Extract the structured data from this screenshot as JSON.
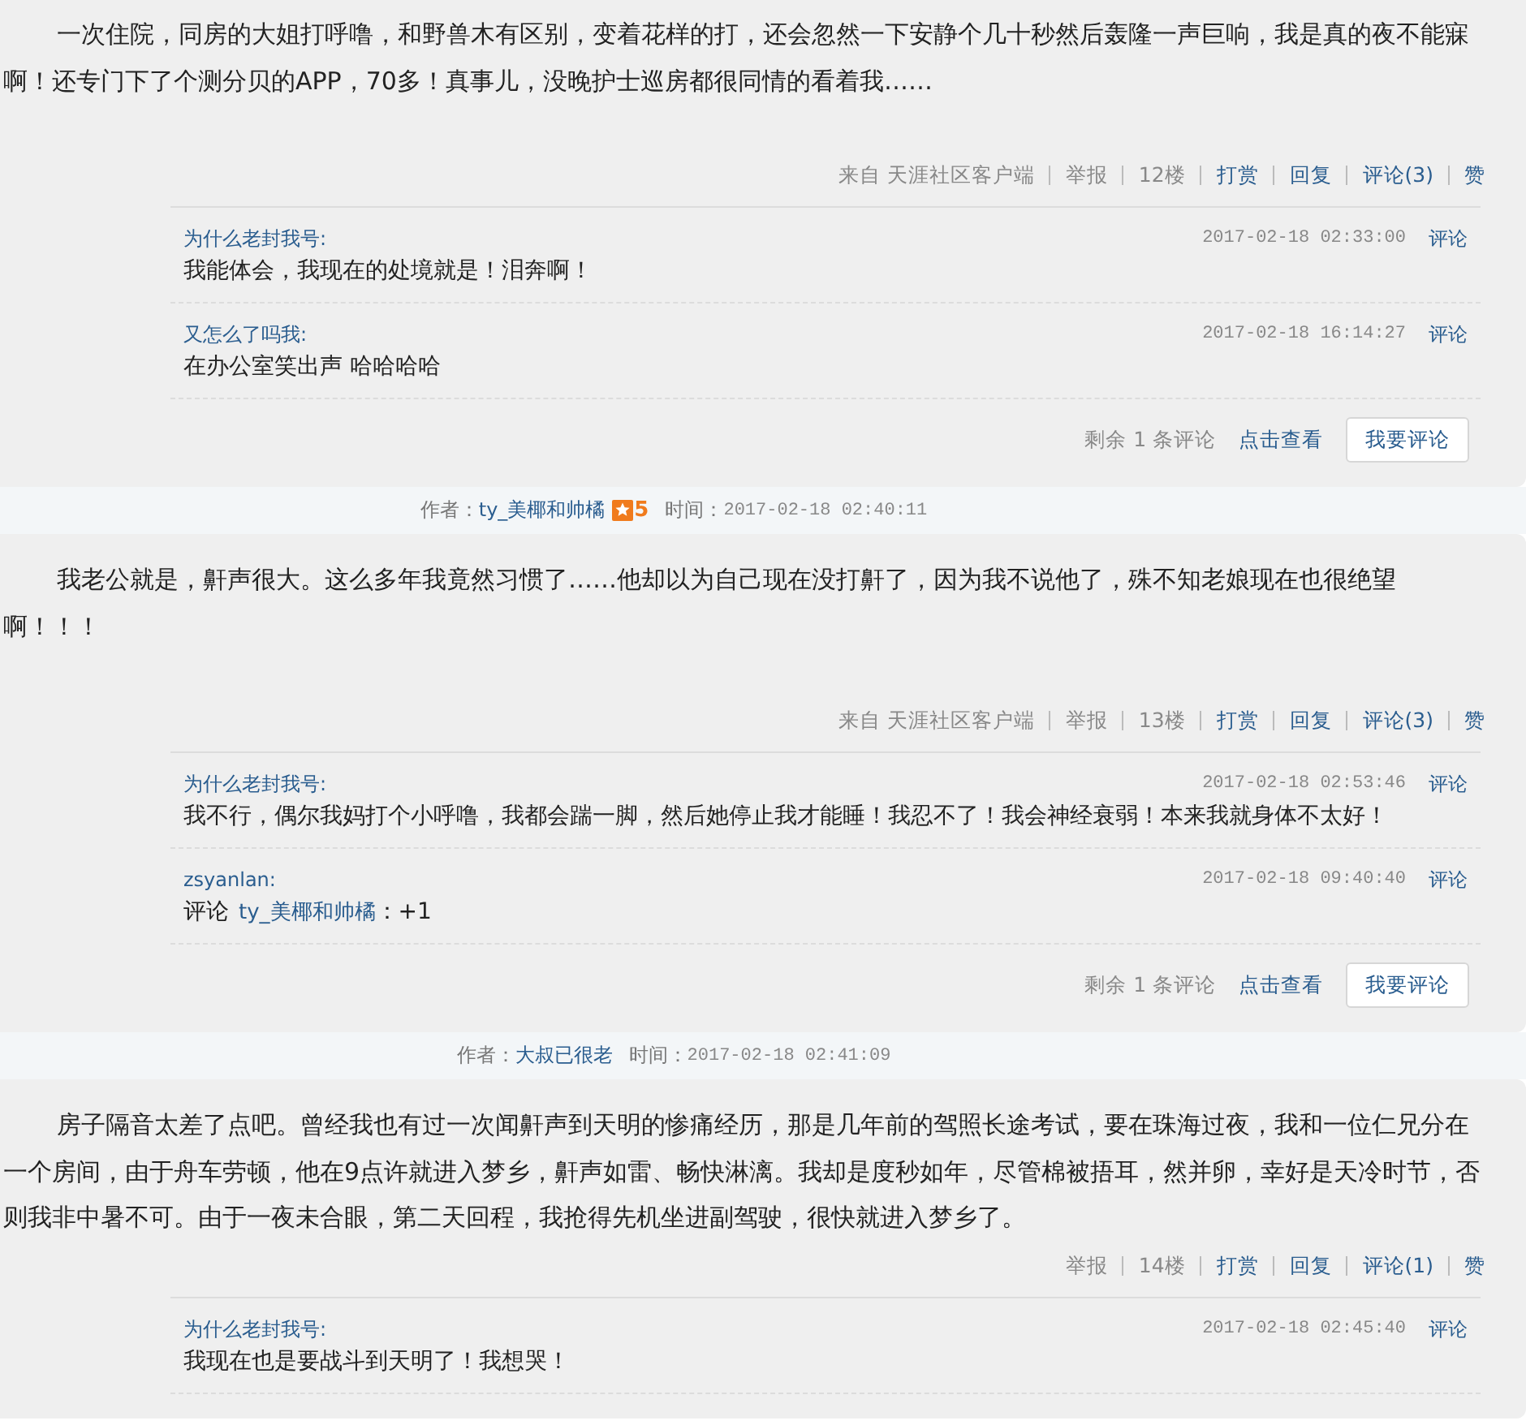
{
  "posts": [
    {
      "body": "一次住院，同房的大姐打呼噜，和野兽木有区别，变着花样的打，还会忽然一下安静个几十秒然后轰隆一声巨响，我是真的夜不能寐啊！还专门下了个测分贝的APP，70多！真事儿，没晚护士巡房都很同情的看着我……",
      "actions": [
        {
          "text": "来自 天涯社区客户端",
          "kind": "info"
        },
        {
          "text": "举报",
          "kind": "info"
        },
        {
          "text": "12楼",
          "kind": "info"
        },
        {
          "text": "打赏",
          "kind": "link"
        },
        {
          "text": "回复",
          "kind": "link"
        },
        {
          "text": "评论(3)",
          "kind": "link"
        },
        {
          "text": "赞",
          "kind": "link"
        }
      ],
      "comments": [
        {
          "user": "为什么老封我号:",
          "time": "2017-02-18 02:33:00",
          "action": "评论",
          "parts": [
            {
              "text": "我能体会，我现在的处境就是！泪奔啊！",
              "kind": "plain"
            }
          ]
        },
        {
          "user": "又怎么了吗我:",
          "time": "2017-02-18 16:14:27",
          "action": "评论",
          "parts": [
            {
              "text": "在办公室笑出声 哈哈哈哈",
              "kind": "plain"
            }
          ]
        }
      ],
      "comment_footer": {
        "remaining": "剩余 1 条评论",
        "view": "点击查看",
        "button": "我要评论"
      }
    },
    {
      "author": {
        "label": "作者：",
        "name": "ty_美椰和帅橘",
        "level": "5",
        "time_label": "时间：",
        "time": "2017-02-18 02:40:11"
      },
      "body": "我老公就是，鼾声很大。这么多年我竟然习惯了……他却以为自己现在没打鼾了，因为我不说他了，殊不知老娘现在也很绝望啊！！！",
      "actions": [
        {
          "text": "来自 天涯社区客户端",
          "kind": "info"
        },
        {
          "text": "举报",
          "kind": "info"
        },
        {
          "text": "13楼",
          "kind": "info"
        },
        {
          "text": "打赏",
          "kind": "link"
        },
        {
          "text": "回复",
          "kind": "link"
        },
        {
          "text": "评论(3)",
          "kind": "link"
        },
        {
          "text": "赞",
          "kind": "link"
        }
      ],
      "comments": [
        {
          "user": "为什么老封我号:",
          "time": "2017-02-18 02:53:46",
          "action": "评论",
          "parts": [
            {
              "text": "我不行，偶尔我妈打个小呼噜，我都会踹一脚，然后她停止我才能睡！我忍不了！我会神经衰弱！本来我就身体不太好！",
              "kind": "plain"
            }
          ]
        },
        {
          "user": "zsyanlan:",
          "time": "2017-02-18 09:40:40",
          "action": "评论",
          "parts": [
            {
              "text": "评论",
              "kind": "plain"
            },
            {
              "text": "ty_美椰和帅橘",
              "kind": "link"
            },
            {
              "text": "：+1",
              "kind": "plain"
            }
          ]
        }
      ],
      "comment_footer": {
        "remaining": "剩余 1 条评论",
        "view": "点击查看",
        "button": "我要评论"
      }
    },
    {
      "author": {
        "label": "作者：",
        "name": "大叔已很老",
        "time_label": "时间：",
        "time": "2017-02-18 02:41:09"
      },
      "body": "房子隔音太差了点吧。曾经我也有过一次闻鼾声到天明的惨痛经历，那是几年前的驾照长途考试，要在珠海过夜，我和一位仁兄分在一个房间，由于舟车劳顿，他在9点许就进入梦乡，鼾声如雷、畅快淋漓。我却是度秒如年，尽管棉被捂耳，然并卵，幸好是天冷时节，否则我非中暑不可。由于一夜未合眼，第二天回程，我抢得先机坐进副驾驶，很快就进入梦乡了。",
      "actions": [
        {
          "text": "举报",
          "kind": "info"
        },
        {
          "text": "14楼",
          "kind": "info"
        },
        {
          "text": "打赏",
          "kind": "link"
        },
        {
          "text": "回复",
          "kind": "link"
        },
        {
          "text": "评论(1)",
          "kind": "link"
        },
        {
          "text": "赞",
          "kind": "link"
        }
      ],
      "comments": [
        {
          "user": "为什么老封我号:",
          "time": "2017-02-18 02:45:40",
          "action": "评论",
          "parts": [
            {
              "text": "我现在也是要战斗到天明了！我想哭！",
              "kind": "plain"
            }
          ]
        }
      ]
    }
  ]
}
